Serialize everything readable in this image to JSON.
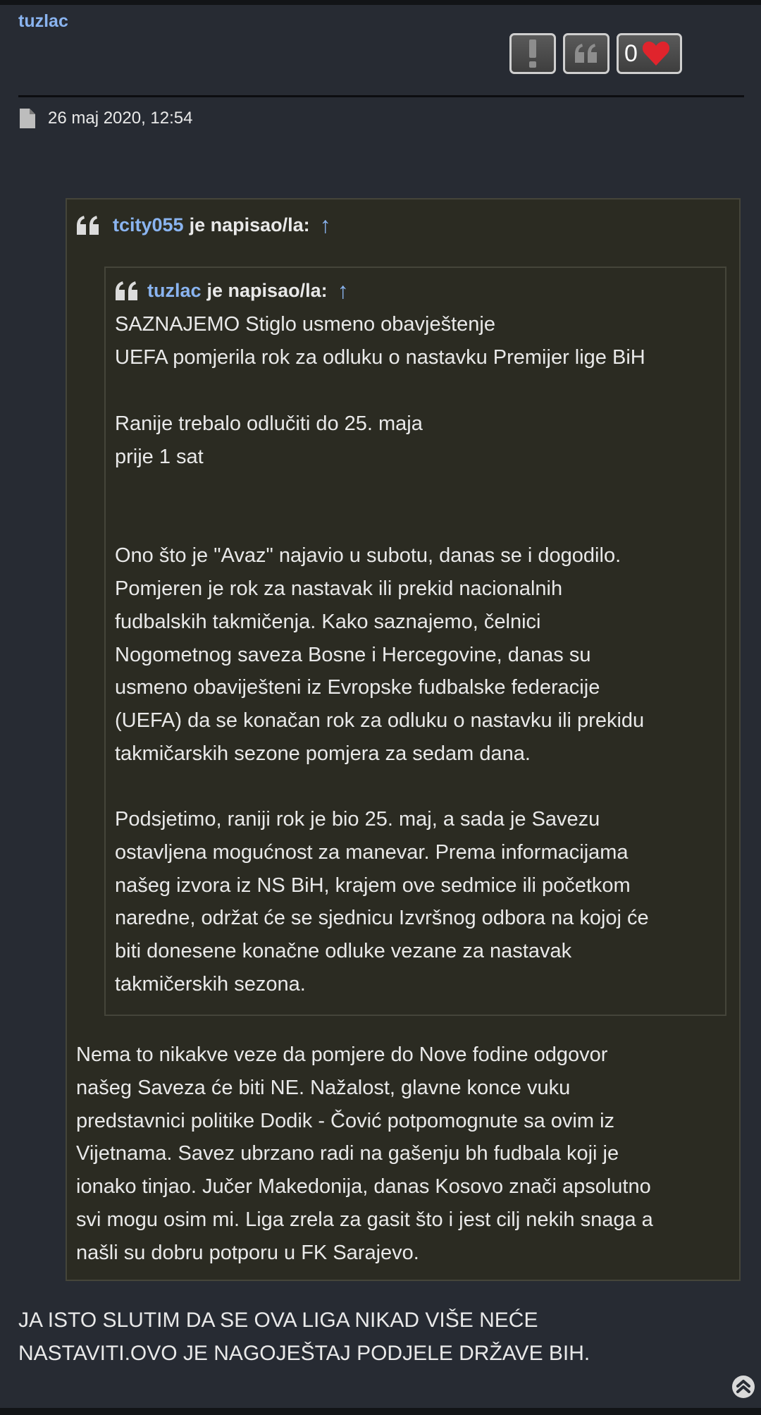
{
  "post": {
    "author": "tuzlac",
    "like_count": "0",
    "date": "26 maj 2020, 12:54"
  },
  "icons": {
    "report": "exclamation-icon",
    "quote": "quote-icon",
    "like": "heart-icon",
    "post": "document-icon",
    "scroll": "chevron-up-circle-icon"
  },
  "colors": {
    "username": "#8ab4f0",
    "heart": "#e0242c",
    "quote_bg": "#2b2b22"
  },
  "outer_quote": {
    "user": "tcity055",
    "wrote": "je napisao/la:",
    "arrow": "↑",
    "reply_lines": [
      "Nema to nikakve veze da pomjere do Nove fodine odgovor",
      "našeg Saveza će biti NE. Nažalost, glavne konce vuku",
      "predstavnici politike Dodik - Čović potpomognute sa ovim iz",
      "Vijetnama. Savez ubrzano radi na gašenju bh fudbala koji je",
      "ionako tinjao. Jučer Makedonija, danas Kosovo znači apsolutno",
      "svi mogu osim mi. Liga zrela za gasit što i jest cilj nekih snaga a",
      "našli su dobru potporu u FK Sarajevo."
    ]
  },
  "inner_quote": {
    "user": "tuzlac",
    "wrote": "je napisao/la:",
    "arrow": "↑",
    "lines": [
      "SAZNAJEMO Stiglo usmeno obavještenje",
      "UEFA pomjerila rok za odluku o nastavku Premijer lige BiH",
      "Ranije trebalo odlučiti do 25. maja",
      "prije 1 sat",
      "Ono što je \"Avaz\" najavio u subotu, danas se i dogodilo.",
      "Pomjeren je rok za nastavak ili prekid nacionalnih",
      "fudbalskih takmičenja. Kako saznajemo, čelnici",
      "Nogometnog saveza Bosne i Hercegovine, danas su",
      "usmeno obaviješteni iz Evropske fudbalske federacije",
      "(UEFA) da se konačan rok za odluku o nastavku ili prekidu",
      "takmičarskih sezone pomjera za sedam dana.",
      "Podsjetimo, raniji rok je bio 25. maj, a sada je Savezu",
      "ostavljena mogućnost za manevar. Prema informacijama",
      "našeg izvora iz NS BiH, krajem ove sedmice ili početkom",
      "naredne, održat će se sjednicu Izvršnog odbora na kojoj će",
      "biti donesene konačne odluke vezane za nastavak",
      "takmičerskih sezona."
    ]
  },
  "post_body_lines": [
    "JA ISTO SLUTIM DA SE OVA LIGA NIKAD VIŠE NEĆE",
    "NASTAVITI.OVO JE NAGOJEŠTAJ PODJELE DRŽAVE BIH."
  ]
}
